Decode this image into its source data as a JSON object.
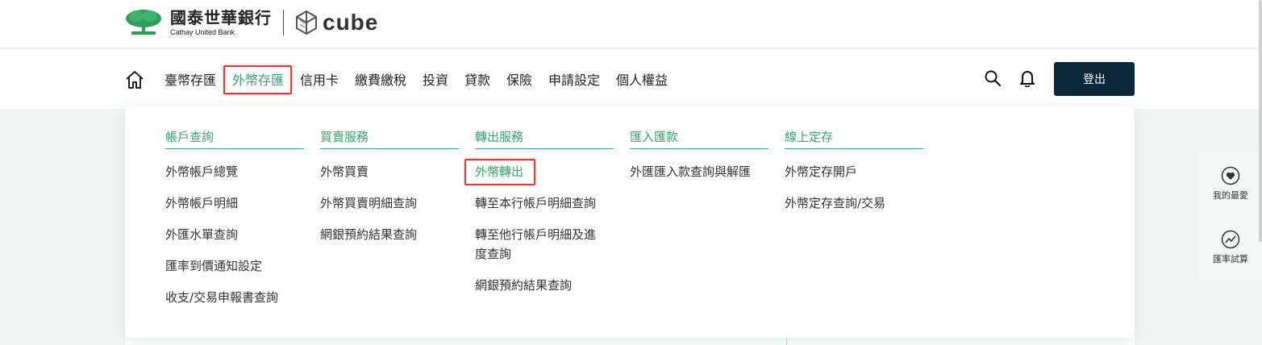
{
  "header": {
    "bank_name_cn": "國泰世華銀行",
    "bank_name_en": "Cathay United Bank",
    "brand": "cube"
  },
  "nav": {
    "items": [
      {
        "label": "臺幣存匯"
      },
      {
        "label": "外幣存匯"
      },
      {
        "label": "信用卡"
      },
      {
        "label": "繳費繳稅"
      },
      {
        "label": "投資"
      },
      {
        "label": "貸款"
      },
      {
        "label": "保險"
      },
      {
        "label": "申請設定"
      },
      {
        "label": "個人權益"
      }
    ],
    "logout_label": "登出"
  },
  "menu": {
    "columns": [
      {
        "title": "帳戶查詢",
        "items": [
          "外幣帳戶總覽",
          "外幣帳戶明細",
          "外匯水單查詢",
          "匯率到價通知設定",
          "收支/交易申報書查詢"
        ]
      },
      {
        "title": "買賣服務",
        "items": [
          "外幣買賣",
          "外幣買賣明細查詢",
          "網銀預約結果查詢"
        ]
      },
      {
        "title": "轉出服務",
        "items": [
          "外幣轉出",
          "轉至本行帳戶明細查詢",
          "轉至他行帳戶明細及進",
          "度查詢",
          "網銀預約結果查詢"
        ]
      },
      {
        "title": "匯入匯款",
        "items": [
          "外匯匯入款查詢與解匯"
        ]
      },
      {
        "title": "線上定存",
        "items": [
          "外幣定存開戶",
          "外幣定存查詢/交易"
        ]
      }
    ]
  },
  "side_panel": {
    "favorites_label": "我的最愛",
    "rate_calc_label": "匯率試算"
  },
  "colors": {
    "accent_green": "#3aa274",
    "logout_bg": "#0c2738",
    "highlight_red": "#e53935"
  }
}
